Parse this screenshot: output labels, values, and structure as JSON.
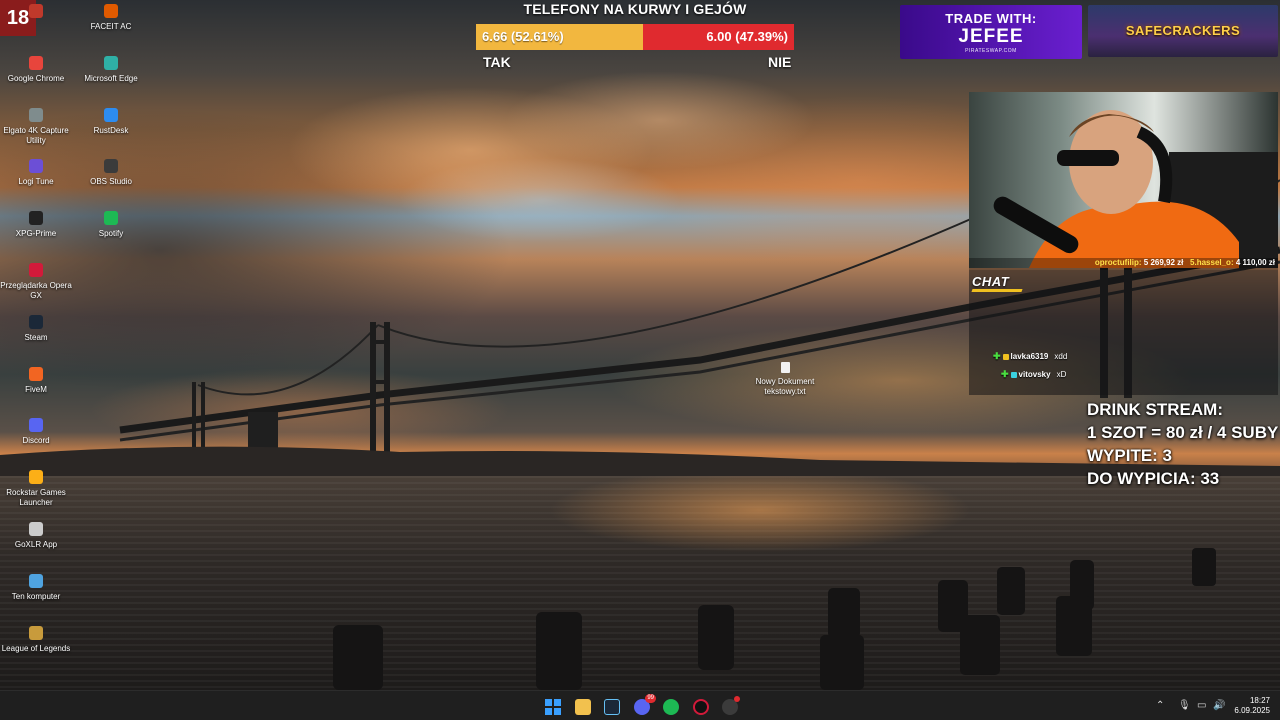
{
  "age_badge": "18",
  "desktop_icons": [
    {
      "label": "",
      "color": "#c0392b"
    },
    {
      "label": "FACEIT AC",
      "color": "#e05a00"
    },
    {
      "label": "Google Chrome",
      "color": "#e8453c"
    },
    {
      "label": "Microsoft Edge",
      "color": "#2fb0a6"
    },
    {
      "label": "Elgato 4K Capture Utility",
      "color": "#7f8c8d"
    },
    {
      "label": "RustDesk",
      "color": "#2d8cf0"
    },
    {
      "label": "Logi Tune",
      "color": "#6c4fd6"
    },
    {
      "label": "OBS Studio",
      "color": "#3b3b3b"
    },
    {
      "label": "XPG-Prime",
      "color": "#222222"
    },
    {
      "label": "Spotify",
      "color": "#1db954"
    },
    {
      "label": "Przeglądarka Opera GX",
      "color": "#d21a3a"
    },
    {
      "label": "Steam",
      "color": "#1b2838"
    },
    {
      "label": "FiveM",
      "color": "#f26522"
    },
    {
      "label": "Discord",
      "color": "#5865f2"
    },
    {
      "label": "Rockstar Games Launcher",
      "color": "#fcaf17"
    },
    {
      "label": "GoXLR App",
      "color": "#cccccc"
    },
    {
      "label": "Ten komputer",
      "color": "#4fa3e0"
    },
    {
      "label": "League of Legends",
      "color": "#c89b3c"
    }
  ],
  "poll": {
    "title": "TELEFONY NA KURWY I GEJÓW",
    "yes_value": "6.66 (52.61%)",
    "no_value": "6.00 (47.39%)",
    "yes_fraction": 0.5261,
    "yes_label": "TAK",
    "no_label": "NIE",
    "yes_color": "#f2b73f",
    "no_color": "#e02a2f"
  },
  "banners": {
    "trade_line1": "TRADE WITH:",
    "trade_line2": "JEFEE",
    "trade_line3": "PIRATESWAP.COM",
    "safe": "SAFECRACKERS"
  },
  "ticker": {
    "user1": "oproctufilip:",
    "amount1": "5 269,92 zł",
    "user2": "5.hassel_o:",
    "amount2": "4 110,00 zł"
  },
  "chat": {
    "title": "CHAT",
    "messages": [
      {
        "user": "lavka6319",
        "text": "xdd"
      },
      {
        "user": "vitovsky",
        "text": "xD"
      }
    ]
  },
  "drink": {
    "line1": "DRINK STREAM:",
    "line2": "1 SZOT = 80 zł / 4 SUBY",
    "line3": "WYPITE: 3",
    "line4": "DO WYPICIA: 33"
  },
  "file": {
    "label": "Nowy Dokument tekstowy.txt"
  },
  "taskbar": {
    "apps": [
      "windows-start",
      "file-explorer",
      "steam",
      "discord",
      "spotify",
      "opera-gx",
      "obs"
    ],
    "discord_badge": "99",
    "time": "18:27",
    "date": "6.09.2025"
  }
}
